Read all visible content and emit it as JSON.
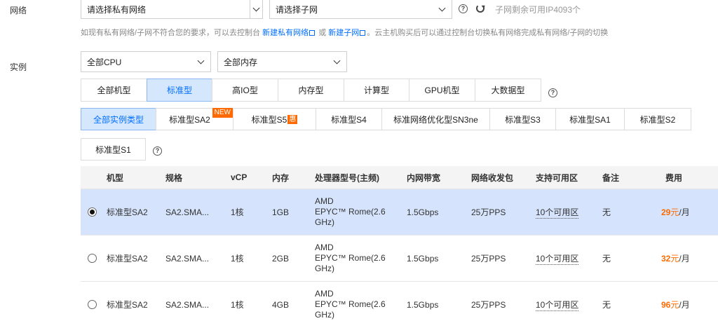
{
  "network": {
    "label": "网络",
    "vpc_select": "请选择私有网络",
    "subnet_select": "请选择子网",
    "remaining": "子网剩余可用IP4093个",
    "hint_prefix": "如现有私有网络/子网不符合您的要求，可以去控制台",
    "hint_link1": "新建私有网络",
    "hint_mid": "或",
    "hint_link2": "新建子网",
    "hint_suffix": "。云主机购买后可以通过控制台切换私有网络完成私有网络/子网的切换"
  },
  "instance": {
    "label": "实例",
    "cpu_select": "全部CPU",
    "memory_select": "全部内存",
    "families": [
      "全部机型",
      "标准型",
      "高IO型",
      "内存型",
      "计算型",
      "GPU机型",
      "大数据型"
    ],
    "active_family": "标准型",
    "types": [
      "全部实例类型",
      "标准型SA2",
      "标准型S5",
      "标准型S4",
      "标准网络优化型SN3ne",
      "标准型S3",
      "标准型SA1",
      "标准型S2",
      "标准型S1"
    ],
    "active_type": "全部实例类型",
    "badge_new": "NEW",
    "badge_hui": "惠"
  },
  "table": {
    "headers": [
      "机型",
      "规格",
      "vCP",
      "内存",
      "处理器型号(主频)",
      "内网带宽",
      "网络收发包",
      "支持可用区",
      "备注",
      "费用"
    ],
    "rows": [
      {
        "model": "标准型SA2",
        "spec": "SA2.SMA...",
        "vcpu": "1核",
        "mem": "1GB",
        "cpu1": "AMD",
        "cpu2": "EPYC™ Rome(2.6",
        "cpu3": "GHz)",
        "bw": "1.5Gbps",
        "pps": "25万PPS",
        "zone": "10个可用区",
        "note": "无",
        "price": "29",
        "unit": "元",
        "per": "/月",
        "selected": true
      },
      {
        "model": "标准型SA2",
        "spec": "SA2.SMA...",
        "vcpu": "1核",
        "mem": "2GB",
        "cpu1": "AMD",
        "cpu2": "EPYC™ Rome(2.6",
        "cpu3": "GHz)",
        "bw": "1.5Gbps",
        "pps": "25万PPS",
        "zone": "10个可用区",
        "note": "无",
        "price": "32",
        "unit": "元",
        "per": "/月",
        "selected": false
      },
      {
        "model": "标准型SA2",
        "spec": "SA2.SMA...",
        "vcpu": "1核",
        "mem": "4GB",
        "cpu1": "AMD",
        "cpu2": "EPYC™ Rome(2.6",
        "cpu3": "GHz)",
        "bw": "1.5Gbps",
        "pps": "25万PPS",
        "zone": "10个可用区",
        "note": "无",
        "price": "96",
        "unit": "元",
        "per": "/月",
        "selected": false
      }
    ]
  },
  "colors": {
    "accent": "#006eff",
    "price": "#ff6a00",
    "selected_row": "#d5e4fc"
  },
  "icons": {
    "help": "question-circle-icon",
    "refresh": "refresh-icon",
    "external": "external-link-icon"
  }
}
